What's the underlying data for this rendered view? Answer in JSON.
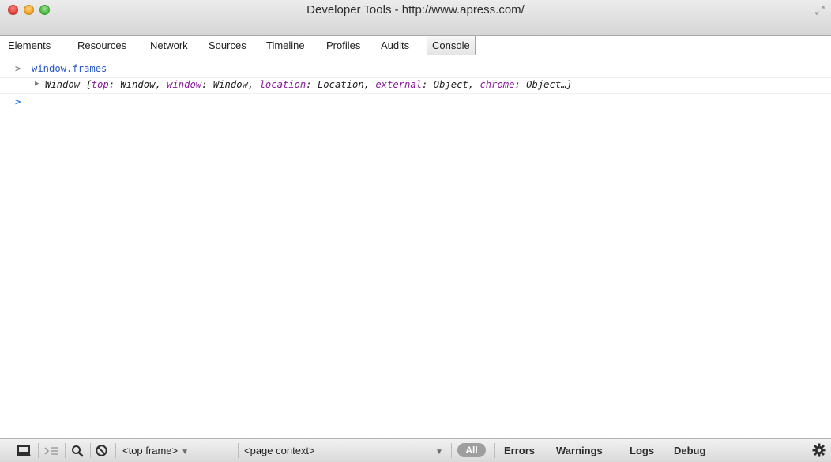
{
  "window": {
    "title": "Developer Tools - http://www.apress.com/",
    "buttons": [
      "close",
      "minimize",
      "zoom"
    ],
    "fullscreen_icon": "fullscreen-icon"
  },
  "tabs": [
    {
      "label": "Elements"
    },
    {
      "label": "Resources"
    },
    {
      "label": "Network"
    },
    {
      "label": "Sources"
    },
    {
      "label": "Timeline"
    },
    {
      "label": "Profiles"
    },
    {
      "label": "Audits"
    },
    {
      "label": "Console",
      "active": true
    }
  ],
  "console": {
    "input_command": "window.frames",
    "result": {
      "prefix": "Window {",
      "entries": [
        {
          "key": "top",
          "value": "Window"
        },
        {
          "key": "window",
          "value": "Window"
        },
        {
          "key": "location",
          "value": "Location"
        },
        {
          "key": "external",
          "value": "Object"
        },
        {
          "key": "chrome",
          "value": "Object"
        }
      ],
      "suffix": "…}"
    },
    "prompt_value": ""
  },
  "statusbar": {
    "icons": [
      "dock-icon",
      "console-drawer-icon",
      "search-icon",
      "clear-icon"
    ],
    "frame_select": "<top frame>",
    "context_select": "<page context>",
    "filters": {
      "all": "All",
      "errors": "Errors",
      "warnings": "Warnings",
      "logs": "Logs",
      "debug": "Debug"
    },
    "settings_icon": "gear-icon"
  },
  "colors": {
    "command": "#2a57c9",
    "object_key": "#8a1a9b",
    "prompt_active": "#2f7fe8",
    "all_pill": "#9e9e9e"
  }
}
